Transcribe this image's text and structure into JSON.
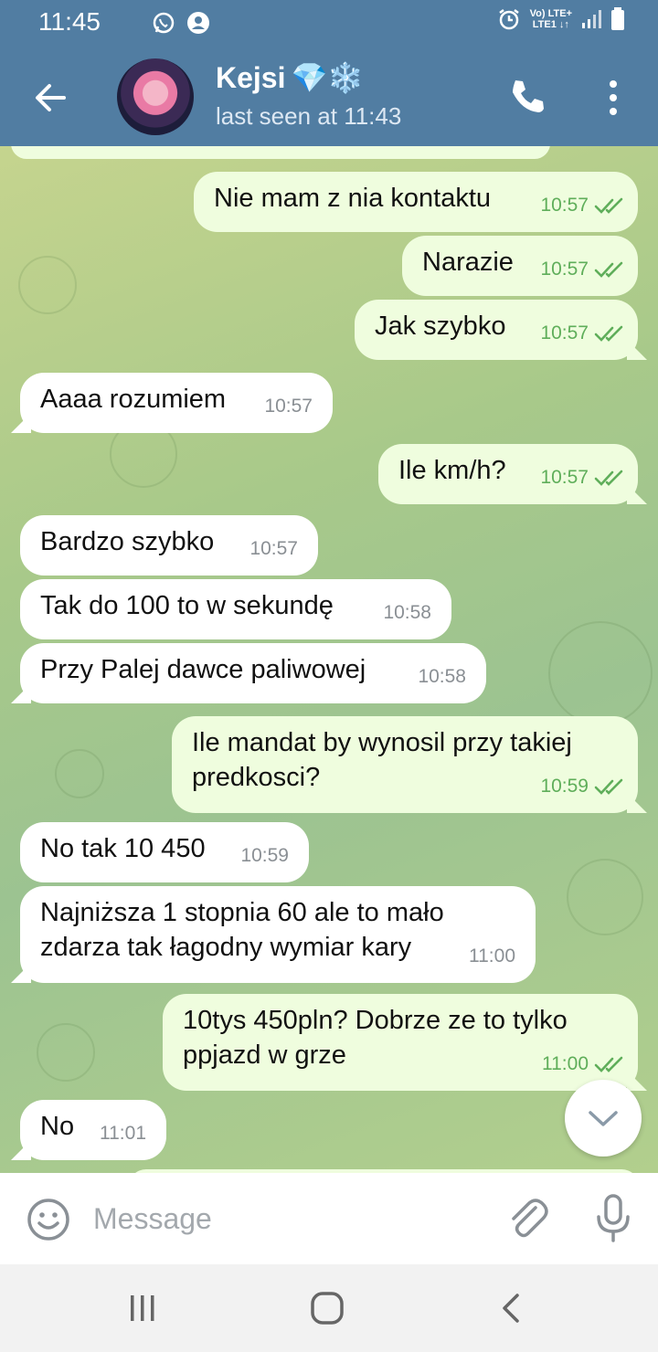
{
  "status_bar": {
    "time": "11:45",
    "network_top": "Vo) LTE+",
    "network_bottom": "LTE1 ↓↑"
  },
  "header": {
    "contact_name": "Kejsi",
    "name_emoji": "💎❄️",
    "last_seen": "last seen at 11:43"
  },
  "messages": [
    {
      "dir": "out",
      "text": "Nie mam z nia kontaktu",
      "time": "10:57"
    },
    {
      "dir": "out",
      "text": "Narazie",
      "time": "10:57"
    },
    {
      "dir": "out",
      "text": "Jak szybko",
      "time": "10:57"
    },
    {
      "dir": "in",
      "text": "Aaaa rozumiem",
      "time": "10:57"
    },
    {
      "dir": "out",
      "text": "Ile km/h?",
      "time": "10:57"
    },
    {
      "dir": "in",
      "text": "Bardzo szybko",
      "time": "10:57"
    },
    {
      "dir": "in",
      "text": "Tak do 100 to w sekundę",
      "time": "10:58"
    },
    {
      "dir": "in",
      "text": "Przy Palej dawce paliwowej",
      "time": "10:58"
    },
    {
      "dir": "out",
      "text": "Ile mandat by wynosil przy takiej\npredkosci?",
      "time": "10:59"
    },
    {
      "dir": "in",
      "text": "No tak 10 450",
      "time": "10:59"
    },
    {
      "dir": "in",
      "text": "Najniższa 1 stopnia 60 ale to  mało\nzdarza tak łagodny wymiar kary",
      "time": "11:00"
    },
    {
      "dir": "out",
      "text": "10tys 450pln?  Dobrze ze to tylko\nppjazd w grze",
      "time": "11:00"
    },
    {
      "dir": "in",
      "text": "No",
      "time": "11:01"
    }
  ],
  "composer": {
    "placeholder": "Message"
  },
  "icons": {
    "back": "arrow-left-icon",
    "call": "phone-icon",
    "more": "more-vertical-icon",
    "emoji": "smiley-icon",
    "attach": "paperclip-icon",
    "mic": "microphone-icon",
    "scroll": "chevron-down-icon"
  },
  "colors": {
    "header": "#517da2",
    "outgoing_bubble": "#effdde",
    "incoming_bubble": "#ffffff",
    "check_color": "#5fae5a"
  }
}
